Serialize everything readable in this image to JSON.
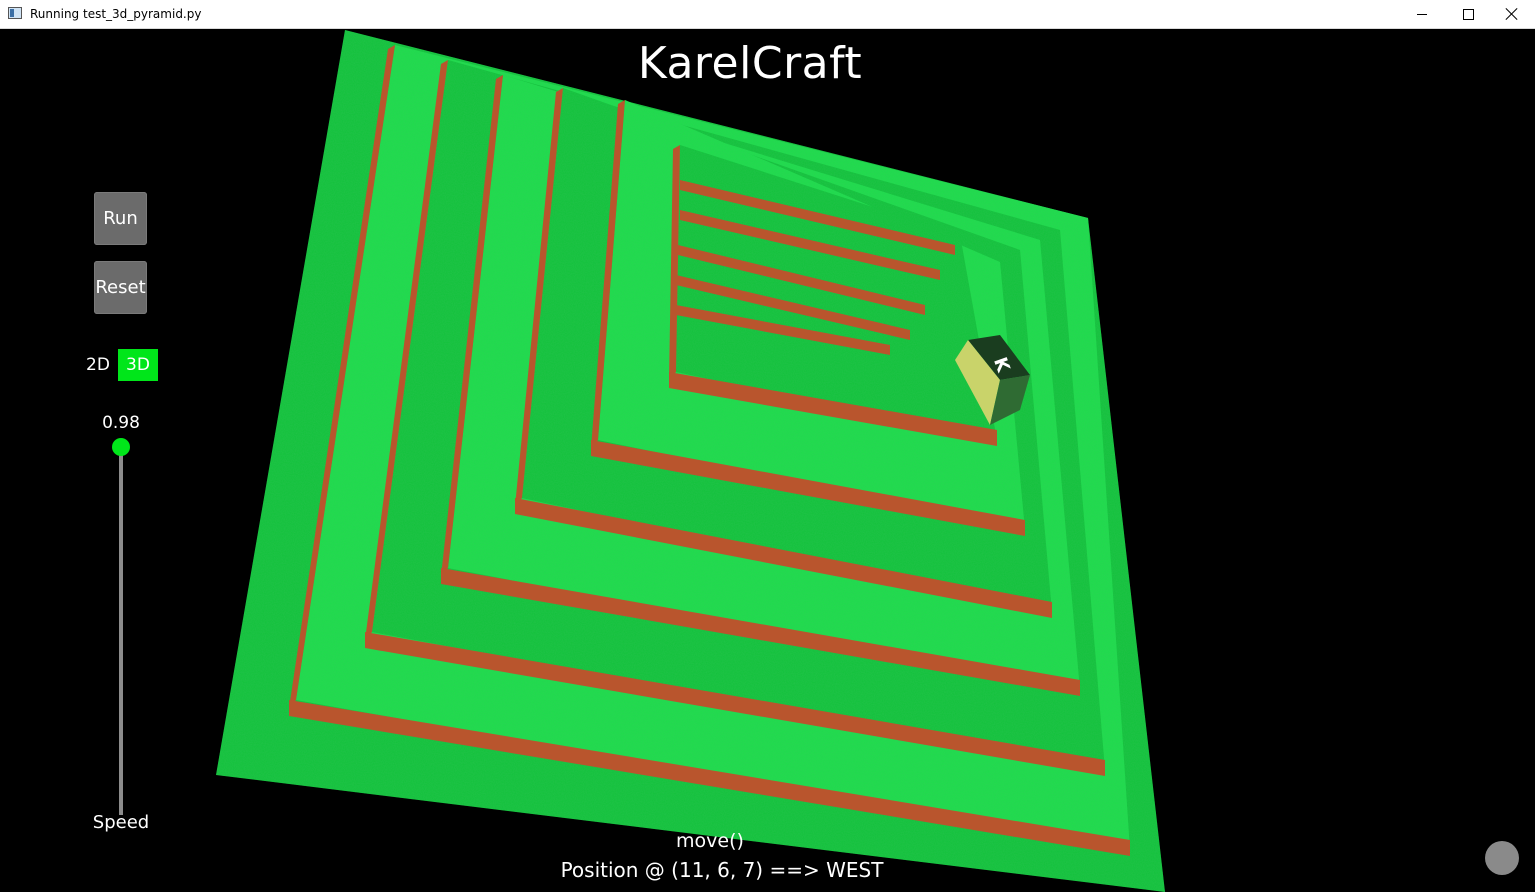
{
  "window": {
    "title": "Running test_3d_pyramid.py"
  },
  "app": {
    "title": "KarelCraft",
    "run_label": "Run",
    "reset_label": "Reset",
    "mode_2d_label": "2D",
    "mode_3d_label": "3D",
    "mode_selected": "3D",
    "speed_value": "0.98",
    "speed": 0.98,
    "speed_label": "Speed",
    "command_text": "move()",
    "position_text": "Position @ (11, 6, 7) ==> WEST",
    "karel_label": "K"
  },
  "colors": {
    "grass": "#12c23a",
    "grass_light": "#1ede4b",
    "brick": "#b9552d",
    "accent": "#00e61a",
    "button": "#6b6b6b"
  }
}
